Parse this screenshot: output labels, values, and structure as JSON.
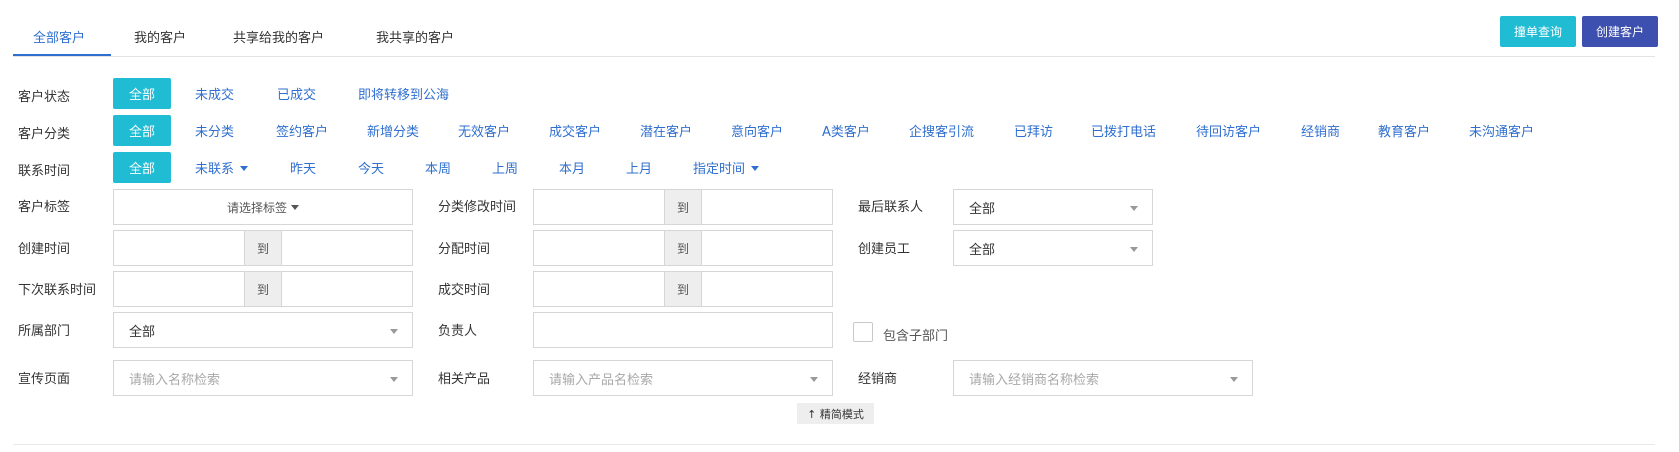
{
  "tabs": [
    {
      "label": "全部客户",
      "active": true
    },
    {
      "label": "我的客户",
      "active": false
    },
    {
      "label": "共享给我的客户",
      "active": false
    },
    {
      "label": "我共享的客户",
      "active": false
    }
  ],
  "actions": {
    "query": "撞单查询",
    "create": "创建客户"
  },
  "status_row": {
    "label": "客户状态",
    "options": [
      "全部",
      "未成交",
      "已成交",
      "即将转移到公海"
    ]
  },
  "category_row": {
    "label": "客户分类",
    "options": [
      "全部",
      "未分类",
      "签约客户",
      "新增分类",
      "无效客户",
      "成交客户",
      "潜在客户",
      "意向客户",
      "A类客户",
      "企搜客引流",
      "已拜访",
      "已拨打电话",
      "待回访客户",
      "经销商",
      "教育客户",
      "未沟通客户"
    ]
  },
  "contact_row": {
    "label": "联系时间",
    "options": [
      "全部",
      "未联系",
      "昨天",
      "今天",
      "本周",
      "上周",
      "本月",
      "上月",
      "指定时间"
    ]
  },
  "fields": {
    "tag": {
      "label": "客户标签",
      "placeholder": "请选择标签"
    },
    "category_modified": {
      "label": "分类修改时间",
      "sep": "到"
    },
    "last_contact": {
      "label": "最后联系人",
      "value": "全部"
    },
    "created": {
      "label": "创建时间",
      "sep": "到"
    },
    "assigned": {
      "label": "分配时间",
      "sep": "到"
    },
    "creator": {
      "label": "创建员工",
      "value": "全部"
    },
    "next_contact": {
      "label": "下次联系时间",
      "sep": "到"
    },
    "deal": {
      "label": "成交时间",
      "sep": "到"
    },
    "department": {
      "label": "所属部门",
      "value": "全部"
    },
    "owner": {
      "label": "负责人",
      "value": ""
    },
    "include_sub": {
      "label": "包含子部门",
      "checked": false
    },
    "promo_page": {
      "label": "宣传页面",
      "placeholder": "请输入名称检索"
    },
    "product": {
      "label": "相关产品",
      "placeholder": "请输入产品名检索"
    },
    "dealer": {
      "label": "经销商",
      "placeholder": "请输入经销商名称检索"
    }
  },
  "compact_toggle": "↑ 精简模式",
  "colors": {
    "accent": "#1fbcd4",
    "primary": "#3d4faf",
    "link": "#2f6fcf"
  }
}
